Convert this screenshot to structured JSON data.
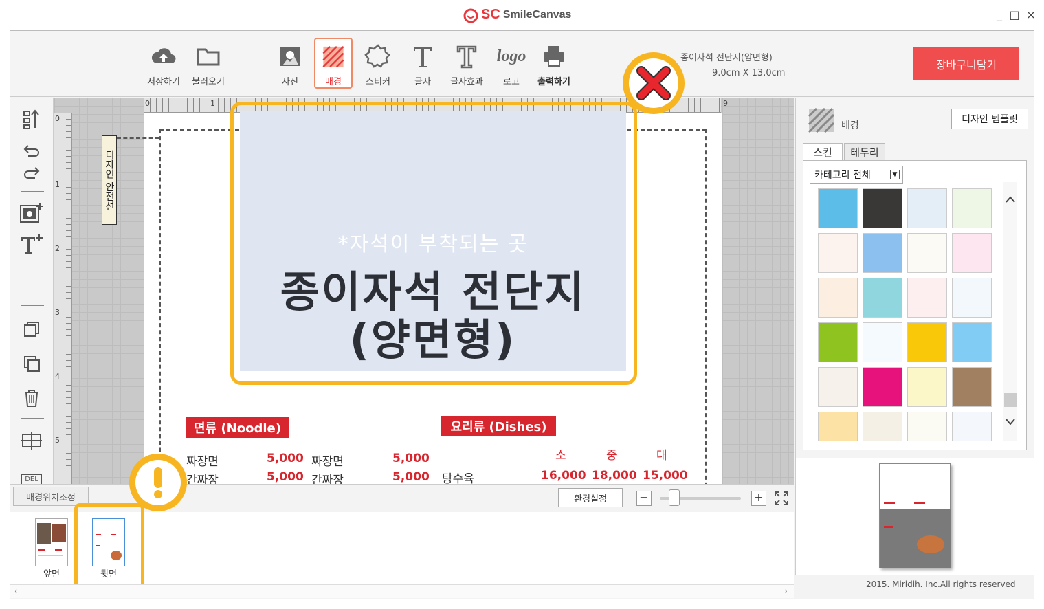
{
  "app": {
    "logo_mark": "SC",
    "name": "SmileCanvas",
    "window_controls": [
      "_",
      "□",
      "×"
    ]
  },
  "toolbar": {
    "save_label": "저장하기",
    "open_label": "불러오기",
    "photo_label": "사진",
    "background_label": "배경",
    "sticker_label": "스티커",
    "text_label": "글자",
    "text_effect_label": "글자효과",
    "logo_label": "로고",
    "print_label": "출력하기",
    "logo_glyph": "logo"
  },
  "document": {
    "title": "종이자석 전단지(양면형)",
    "size": "9.0cm X 13.0cm"
  },
  "cart_button": "장바구니담기",
  "left_tools": {
    "delete_label": "DEL"
  },
  "ruler": {
    "top": [
      "0",
      "1",
      "9"
    ],
    "left": [
      "0",
      "1",
      "2",
      "3",
      "4",
      "5"
    ]
  },
  "canvas": {
    "safe_line_label": "디자인 안전선",
    "magnet_note": "*자석이 부착되는 곳",
    "magnet_title_line1": "종이자석 전단지",
    "magnet_title_line2": "(양면형)",
    "noodle_tag": "면류 (Noodle)",
    "dishes_tag": "요리류 (Dishes)",
    "size_headers": [
      "소",
      "중",
      "대"
    ],
    "noodle_rows": [
      {
        "name": "짜장면",
        "price": "5,000",
        "name2": "짜장면",
        "price2": "5,000"
      },
      {
        "name": "간짜장",
        "price": "5,000",
        "name2": "간짜장",
        "price2": "5,000"
      }
    ],
    "dish_row": {
      "name": "탕수육",
      "small": "16,000",
      "medium": "18,000",
      "large": "15,000"
    }
  },
  "bottom": {
    "bg_position_tab": "배경위치조정",
    "settings_button": "환경설정",
    "zoom_out": "−",
    "zoom_in": "+"
  },
  "pages": {
    "front_label": "앞면",
    "back_label": "뒷면"
  },
  "right_panel": {
    "section_title": "배경",
    "design_template_button": "디자인 템플릿",
    "tab_skin": "스킨",
    "tab_border": "테두리",
    "category_select": "카테고리 전체",
    "swatch_colors": [
      [
        "#5bbde8",
        "#3a3836",
        "#e4eef6",
        "#eef6e6"
      ],
      [
        "#fdf3ee",
        "#8cc0ee",
        "#fbfaf4",
        "#fde6ef"
      ],
      [
        "#fdeee2",
        "#8fd6df",
        "#fdeff0",
        "#f2f8fc"
      ],
      [
        "#8fc31f",
        "#f5faff",
        "#f9c809",
        "#80ccf5"
      ],
      [
        "#f7f1ec",
        "#e8127c",
        "#fbf7c8",
        "#a08060"
      ],
      [
        "#fde2a6",
        "#f4f0e6",
        "#fbfbf3",
        "#f4f8fc"
      ]
    ]
  },
  "footer": {
    "copyright": "2015. Miridih. Inc.All rights reserved"
  },
  "colors": {
    "accent_red": "#e8383d",
    "highlight_yellow": "#f7b521"
  }
}
